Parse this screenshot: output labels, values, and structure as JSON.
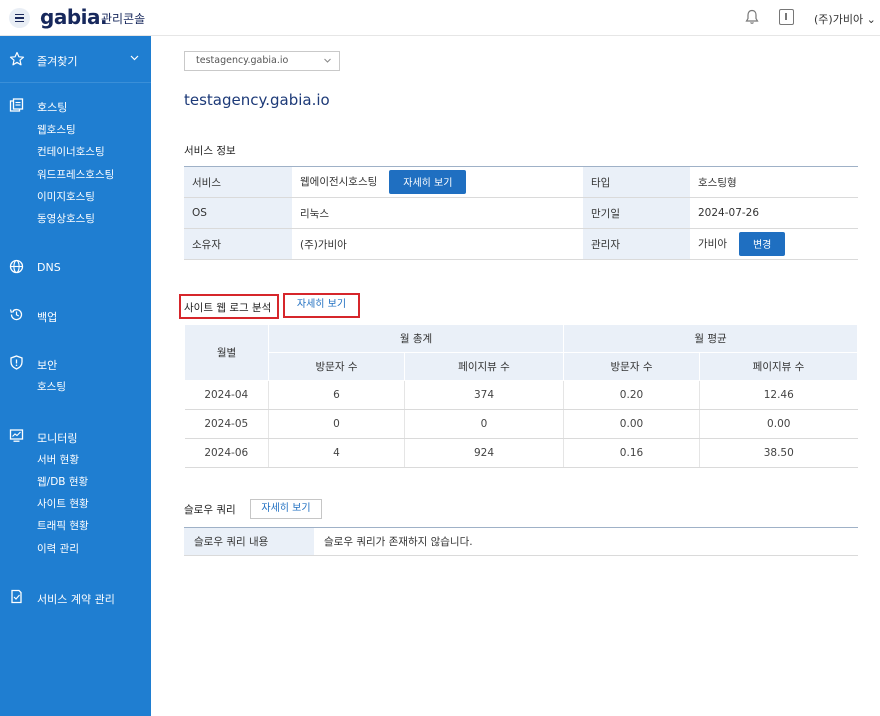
{
  "header": {
    "logo": "gabia.",
    "app_title": "관리콘솔",
    "user_menu": "(주)가비아"
  },
  "sidebar": {
    "favorites": "즐겨찾기",
    "groups": [
      {
        "title": "호스팅",
        "icon": "hosting-icon",
        "items": [
          "웹호스팅",
          "컨테이너호스팅",
          "워드프레스호스팅",
          "이미지호스팅",
          "동영상호스팅"
        ]
      },
      {
        "title": "DNS",
        "icon": "globe-icon",
        "items": []
      },
      {
        "title": "백업",
        "icon": "backup-icon",
        "items": []
      },
      {
        "title": "보안",
        "icon": "shield-icon",
        "items": [
          "호스팅"
        ]
      },
      {
        "title": "모니터링",
        "icon": "monitor-icon",
        "items": [
          "서버 현황",
          "웹/DB 현황",
          "사이트 현황",
          "트래픽 현황",
          "이력 관리"
        ]
      },
      {
        "title": "서비스 계약 관리",
        "icon": "contract-icon",
        "items": []
      }
    ]
  },
  "domain_select": {
    "value": "testagency.gabia.io"
  },
  "domain_title": "testagency.gabia.io",
  "service_info": {
    "title": "서비스 정보",
    "rows": [
      {
        "k1": "서비스",
        "v1": "웹에이전시호스팅",
        "k2": "타입",
        "v2": "호스팅형"
      },
      {
        "k1": "OS",
        "v1": "리눅스",
        "k2": "만기일",
        "v2": "2024-07-26"
      },
      {
        "k1": "소유자",
        "v1": "(주)가비아",
        "k2": "관리자",
        "v2": "가비아"
      }
    ],
    "detail_button": "자세히 보기",
    "change_button": "변경"
  },
  "log_analysis": {
    "title": "사이트 웹 로그 분석",
    "detail_button": "자세히 보기",
    "headers": {
      "month": "월별",
      "monthly_total": "월 총계",
      "monthly_avg": "월 평균",
      "visitors": "방문자 수",
      "pageviews": "페이지뷰 수"
    },
    "rows": [
      {
        "month": "2024-04",
        "total_visitors": "6",
        "total_pageviews": "374",
        "avg_visitors": "0.20",
        "avg_pageviews": "12.46"
      },
      {
        "month": "2024-05",
        "total_visitors": "0",
        "total_pageviews": "0",
        "avg_visitors": "0.00",
        "avg_pageviews": "0.00"
      },
      {
        "month": "2024-06",
        "total_visitors": "4",
        "total_pageviews": "924",
        "avg_visitors": "0.16",
        "avg_pageviews": "38.50"
      }
    ]
  },
  "slow_query": {
    "title": "슬로우 쿼리",
    "detail_button": "자세히 보기",
    "label": "슬로우 쿼리 내용",
    "value": "슬로우 쿼리가 존재하지 않습니다."
  },
  "colors": {
    "sidebar": "#1f7ed1",
    "accent": "#1f6fc1",
    "highlight": "#d6262b",
    "table_header": "#eaf0f8"
  }
}
